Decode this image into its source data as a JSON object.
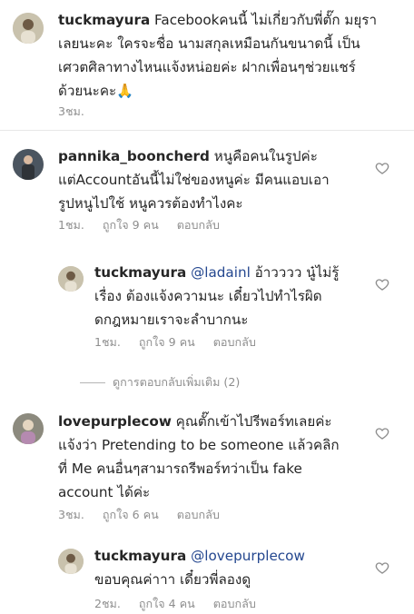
{
  "comments": [
    {
      "username": "tuckmayura",
      "text": [
        " Facebookคนนี้ ไม่เกี่ยวกับพี่ตั๊ก มยุรา",
        "เลยนะคะ ใครจะชื่อ นามสกุลเหมือนกันขนาดนี้ เป็น",
        "เศวตศิลาทางไหนแจ้งหน่อยค่ะ ฝากเพื่อนๆช่วยแชร์",
        "ด้วยนะคะ🙏"
      ],
      "time": "3ชม."
    },
    {
      "username": "pannika_booncherd",
      "text": [
        " หนูคือคนในรูปค่ะ",
        "แต่Accountอันนี้ไม่ใช่ของหนูค่ะ มีคนแอบเอา",
        "รูปหนูไปใช้ หนูควรต้องทำไงคะ"
      ],
      "time": "1ชม.",
      "likes": "ถูกใจ 9 คน",
      "reply": "ตอบกลับ"
    },
    {
      "username": "tuckmayura",
      "mention": "@ladainl",
      "text": [
        " อ้าวววว นู๋ไม่รู้",
        "เรื่อง ต้องแจ้งความนะ เดี๋ยวไปทำไรผิด",
        "ดกฎหมายเราจะลำบากนะ"
      ],
      "time": "1ชม.",
      "likes": "ถูกใจ 9 คน",
      "reply": "ตอบกลับ"
    },
    {
      "username": "lovepurplecow",
      "text": [
        " คุณตั๊กเข้าไปรีพอร์ทเลยค่ะ",
        "แจ้งว่า Pretending to be someone แล้วคลิก",
        "ที่ Me คนอื่นๆสามารถรีพอร์ทว่าเป็น fake",
        "account ได้ค่ะ"
      ],
      "time": "3ชม.",
      "likes": "ถูกใจ 6 คน",
      "reply": "ตอบกลับ"
    },
    {
      "username": "tuckmayura",
      "mention": "@lovepurplecow",
      "text": [
        "",
        "ขอบคุณค่าาา เดี๋ยวพี่ลองดู"
      ],
      "time": "2ชม.",
      "likes": "ถูกใจ 4 คน",
      "reply": "ตอบกลับ"
    }
  ],
  "more_replies": "ดูการตอบกลับเพิ่มเติม (2)",
  "colors": {
    "mention": "#24478f",
    "meta": "#8e8e8e",
    "text": "#262626"
  },
  "icons": {
    "like": "heart-outline-icon"
  }
}
